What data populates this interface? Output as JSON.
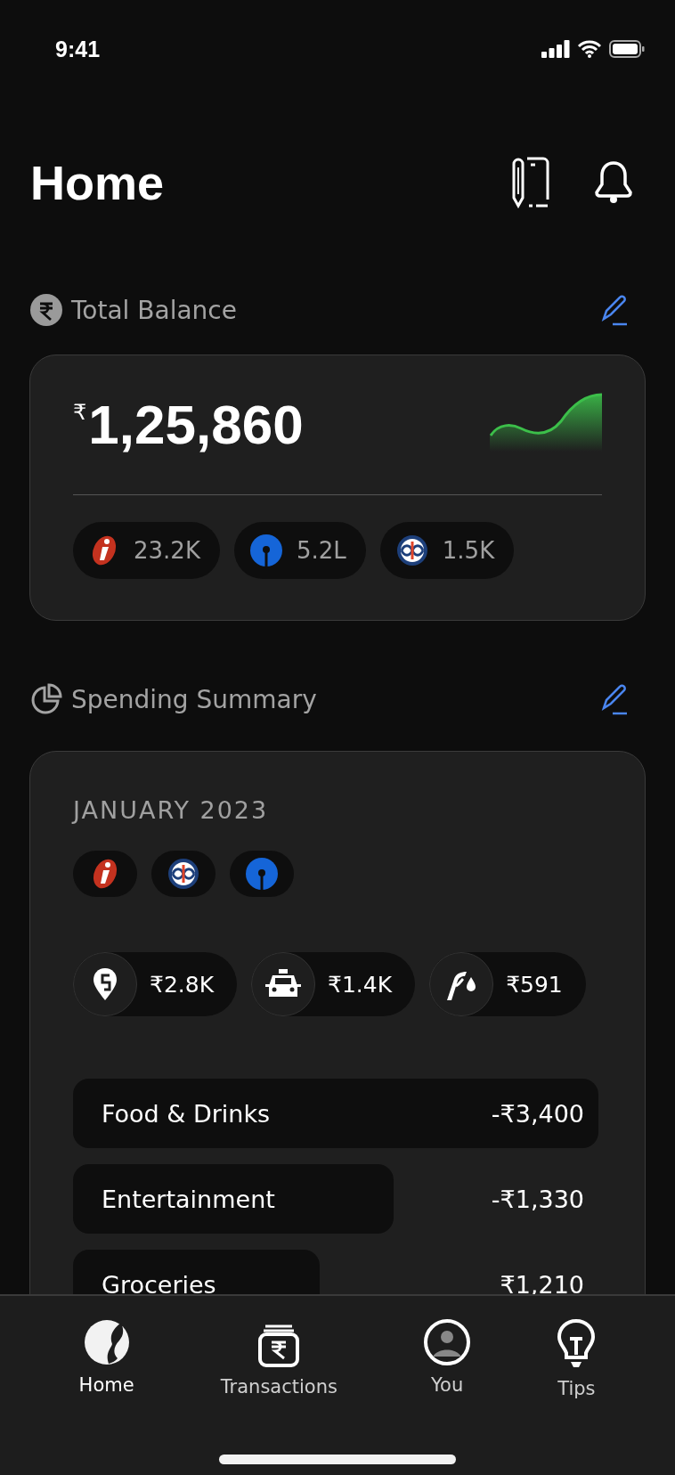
{
  "status_bar": {
    "time": "9:41"
  },
  "header": {
    "title": "Home"
  },
  "total_balance": {
    "label": "Total Balance",
    "currency": "₹",
    "amount": "1,25,860",
    "accounts": [
      {
        "kind": "icici",
        "amount": "23.2K"
      },
      {
        "kind": "sbi",
        "amount": "5.2L"
      },
      {
        "kind": "kotak",
        "amount": "1.5K"
      }
    ]
  },
  "spending_summary": {
    "label": "Spending Summary",
    "month": "JANUARY 2023",
    "banks": [
      {
        "kind": "icici"
      },
      {
        "kind": "kotak"
      },
      {
        "kind": "sbi"
      }
    ],
    "merchants": [
      {
        "kind": "food",
        "amount": "₹2.8K"
      },
      {
        "kind": "taxi",
        "amount": "₹1.4K"
      },
      {
        "kind": "fuel",
        "amount": "₹591"
      }
    ],
    "categories": [
      {
        "name": "Food & Drinks",
        "amount": "-₹3,400"
      },
      {
        "name": "Entertainment",
        "amount": "-₹1,330"
      },
      {
        "name": "Groceries",
        "amount": "₹1,210"
      }
    ]
  },
  "tab_bar": [
    {
      "kind": "home",
      "label": "Home",
      "selected": true
    },
    {
      "kind": "transactions",
      "label": "Transactions",
      "selected": false
    },
    {
      "kind": "you",
      "label": "You",
      "selected": false
    },
    {
      "kind": "tips",
      "label": "Tips",
      "selected": false
    }
  ]
}
